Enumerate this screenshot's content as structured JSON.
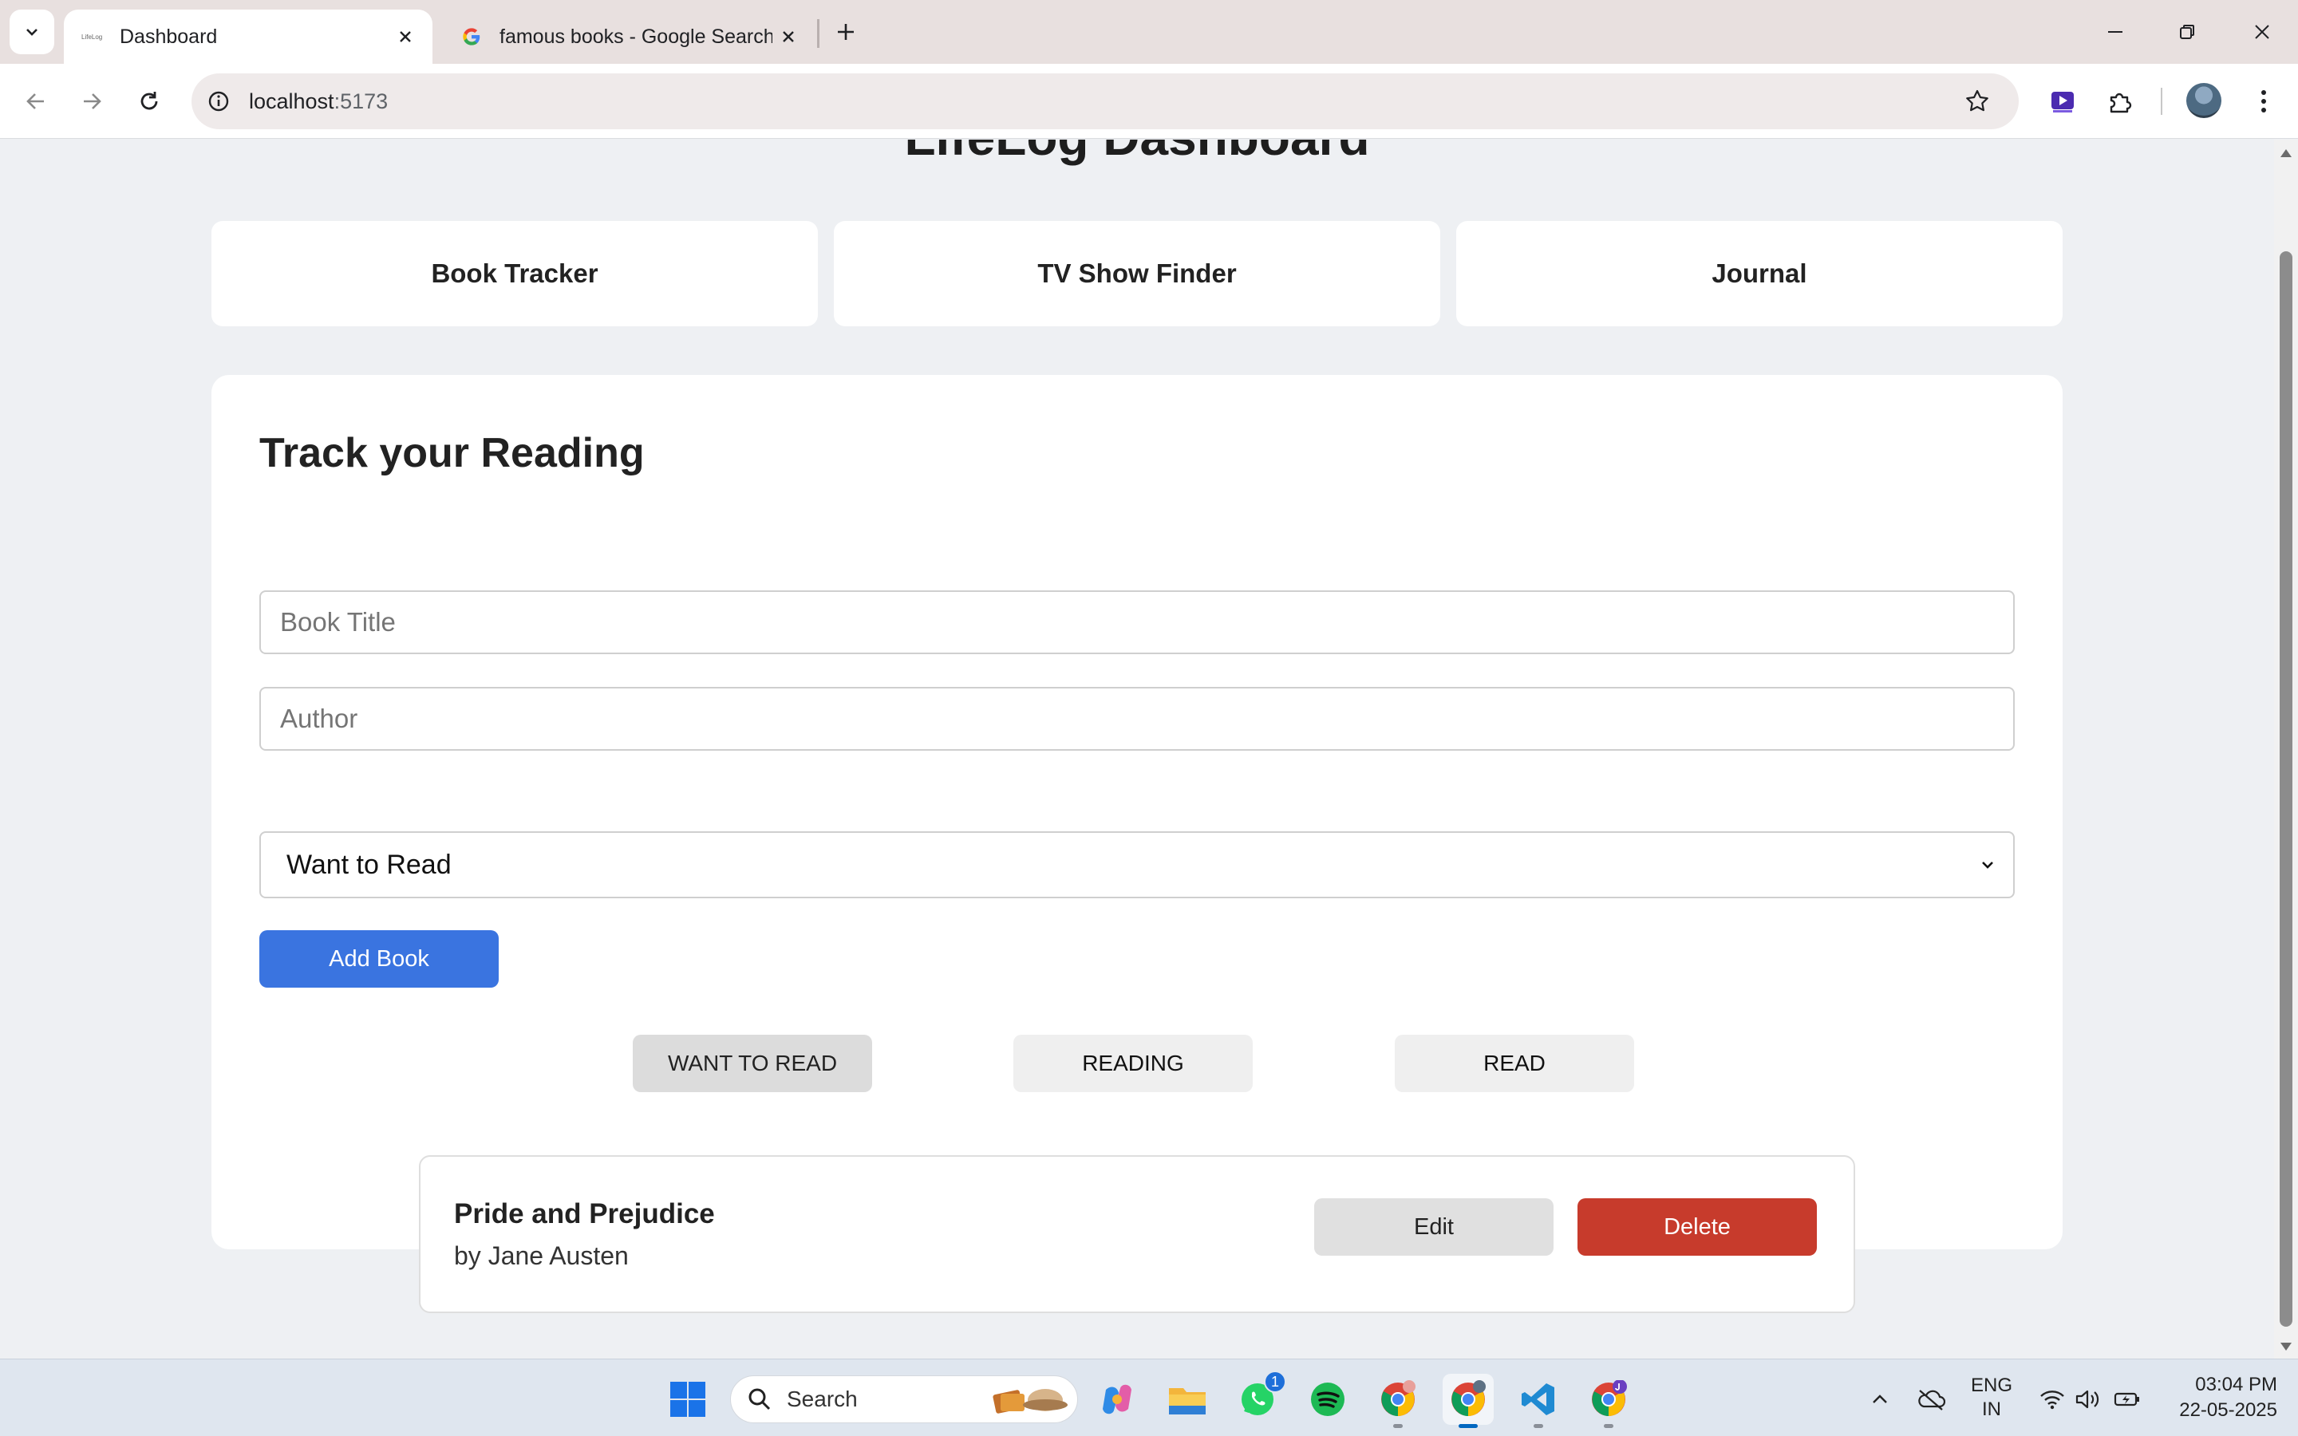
{
  "browser": {
    "tabs": [
      {
        "title": "Dashboard",
        "active": true
      },
      {
        "title": "famous books - Google Search",
        "active": false
      }
    ],
    "url_host": "localhost",
    "url_port": ":5173"
  },
  "page": {
    "title": "LifeLog Dashboard",
    "nav": [
      "Book Tracker",
      "TV Show Finder",
      "Journal"
    ]
  },
  "form": {
    "heading": "Track your Reading",
    "title_placeholder": "Book Title",
    "author_placeholder": "Author",
    "status_selected": "Want to Read",
    "add_label": "Add Book"
  },
  "filters": {
    "items": [
      "WANT TO READ",
      "READING",
      "READ"
    ],
    "selected": "WANT TO READ"
  },
  "books": [
    {
      "title": "Pride and Prejudice",
      "author": "by Jane Austen",
      "edit_label": "Edit",
      "delete_label": "Delete"
    }
  ],
  "taskbar": {
    "search_label": "Search",
    "whatsapp_badge": "1",
    "lang_line1": "ENG",
    "lang_line2": "IN",
    "time": "03:04 PM",
    "date": "22-05-2025"
  },
  "colors": {
    "primary": "#3a74e0",
    "danger": "#c73b2c",
    "page_bg": "#eef0f3"
  }
}
